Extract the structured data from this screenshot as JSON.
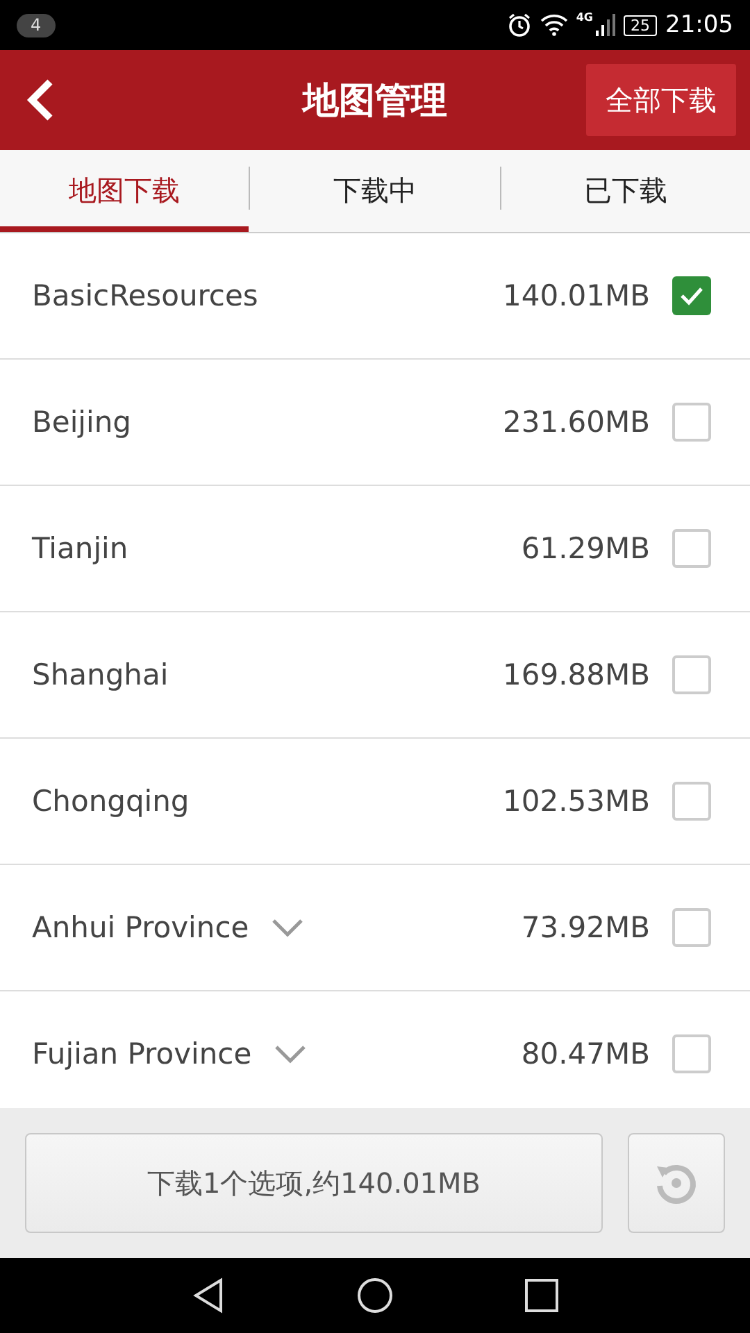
{
  "status_bar": {
    "notification_count": "4",
    "network": "4G",
    "battery": "25",
    "time": "21:05"
  },
  "header": {
    "title": "地图管理",
    "action": "全部下载"
  },
  "tabs": [
    {
      "label": "地图下载",
      "selected": true
    },
    {
      "label": "下载中",
      "selected": false
    },
    {
      "label": "已下载",
      "selected": false
    }
  ],
  "maps": [
    {
      "name": "BasicResources",
      "size": "140.01MB",
      "checked": true,
      "expandable": false
    },
    {
      "name": "Beijing",
      "size": "231.60MB",
      "checked": false,
      "expandable": false
    },
    {
      "name": "Tianjin",
      "size": "61.29MB",
      "checked": false,
      "expandable": false
    },
    {
      "name": "Shanghai",
      "size": "169.88MB",
      "checked": false,
      "expandable": false
    },
    {
      "name": "Chongqing",
      "size": "102.53MB",
      "checked": false,
      "expandable": false
    },
    {
      "name": "Anhui Province",
      "size": "73.92MB",
      "checked": false,
      "expandable": true
    },
    {
      "name": "Fujian Province",
      "size": "80.47MB",
      "checked": false,
      "expandable": true
    }
  ],
  "footer": {
    "download_button": "下载1个选项,约140.01MB"
  }
}
